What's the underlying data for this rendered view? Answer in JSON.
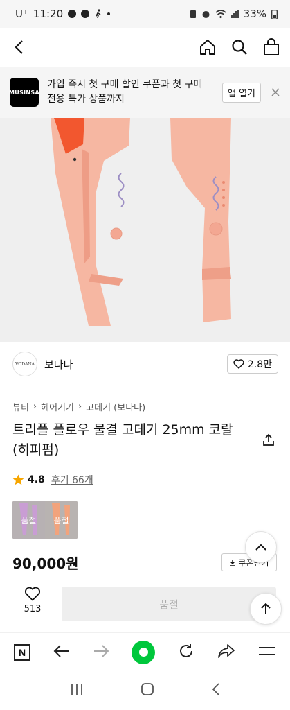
{
  "status_bar": {
    "carrier": "U⁺",
    "time": "11:20",
    "battery": "33%"
  },
  "top_nav": {
    "back_icon": "chevron-left-icon",
    "home_icon": "home-icon",
    "search_icon": "search-icon",
    "cart_icon": "shopping-bag-icon"
  },
  "banner": {
    "logo_text": "MUSINSA",
    "message_line1": "가입 즉시 첫 구매 할인 쿠폰과 첫 구매",
    "message_line2": "전용 특가 상품까지",
    "app_open_label": "앱 열기",
    "close_symbol": "×"
  },
  "brand": {
    "logo_text": "VODANA",
    "name": "보다나",
    "like_count": "2.8만"
  },
  "product": {
    "breadcrumb": [
      "뷰티",
      "헤어기기",
      "고데기 (보다나)"
    ],
    "breadcrumb_sep": "›",
    "title_line1": "트리플 플로우 물결 고데기 25mm 코랄",
    "title_line2": "(히피펌)",
    "rating": "4.8",
    "review_label": "후기 66개",
    "options": [
      {
        "label": "품절",
        "color": "#c99dd4"
      },
      {
        "label": "품절",
        "color": "#f2a37c"
      }
    ],
    "price": "90,000원",
    "coupon_label": "쿠폰받기",
    "accent_color": "#f4b19c"
  },
  "action_bar": {
    "like_count": "513",
    "buy_label": "품절"
  },
  "browser_bar": {
    "n_label": "N"
  }
}
